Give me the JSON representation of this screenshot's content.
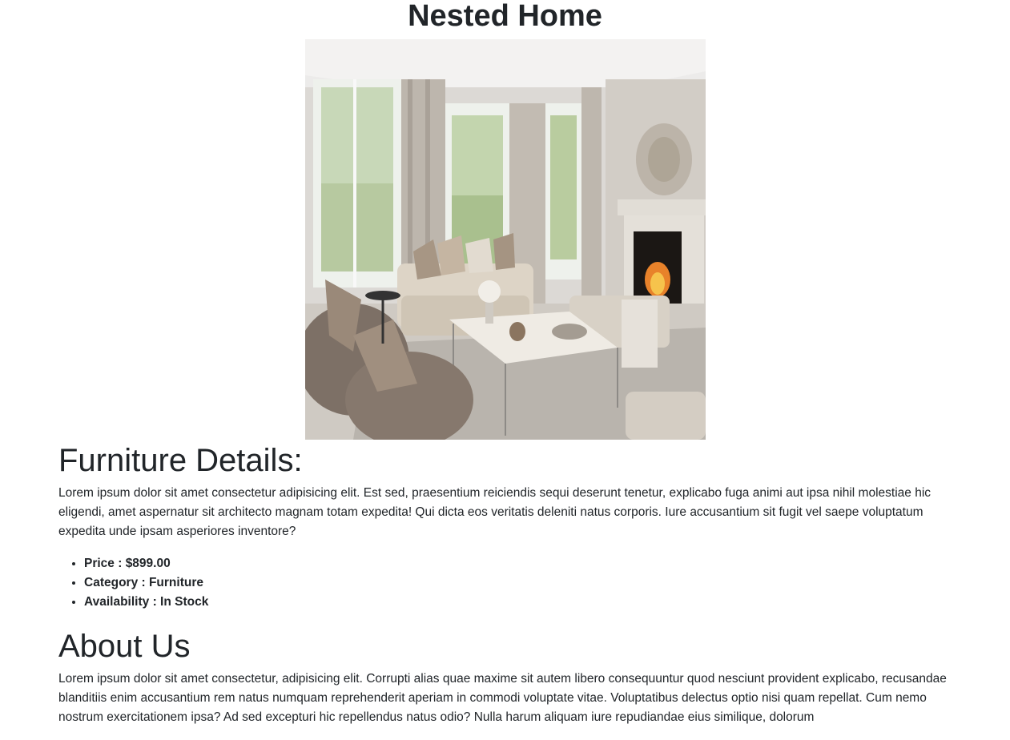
{
  "header": {
    "title": "Nested Home"
  },
  "hero_image": {
    "description": "living-room-photo"
  },
  "furniture": {
    "heading": "Furniture Details:",
    "description": "Lorem ipsum dolor sit amet consectetur adipisicing elit. Est sed, praesentium reiciendis sequi deserunt tenetur, explicabo fuga animi aut ipsa nihil molestiae hic eligendi, amet aspernatur sit architecto magnam totam expedita! Qui dicta eos veritatis deleniti natus corporis. Iure accusantium sit fugit vel saepe voluptatum expedita unde ipsam asperiores inventore?",
    "details": [
      {
        "text": "Price : $899.00"
      },
      {
        "text": "Category : Furniture"
      },
      {
        "text": "Availability : In Stock"
      }
    ]
  },
  "about": {
    "heading": "About Us",
    "text": "Lorem ipsum dolor sit amet consectetur, adipisicing elit. Corrupti alias quae maxime sit autem libero consequuntur quod nesciunt provident explicabo, recusandae blanditiis enim accusantium rem natus numquam reprehenderit aperiam in commodi voluptate vitae. Voluptatibus delectus optio nisi quam repellat. Cum nemo nostrum exercitationem ipsa? Ad sed excepturi hic repellendus natus odio? Nulla harum aliquam iure repudiandae eius similique, dolorum"
  }
}
